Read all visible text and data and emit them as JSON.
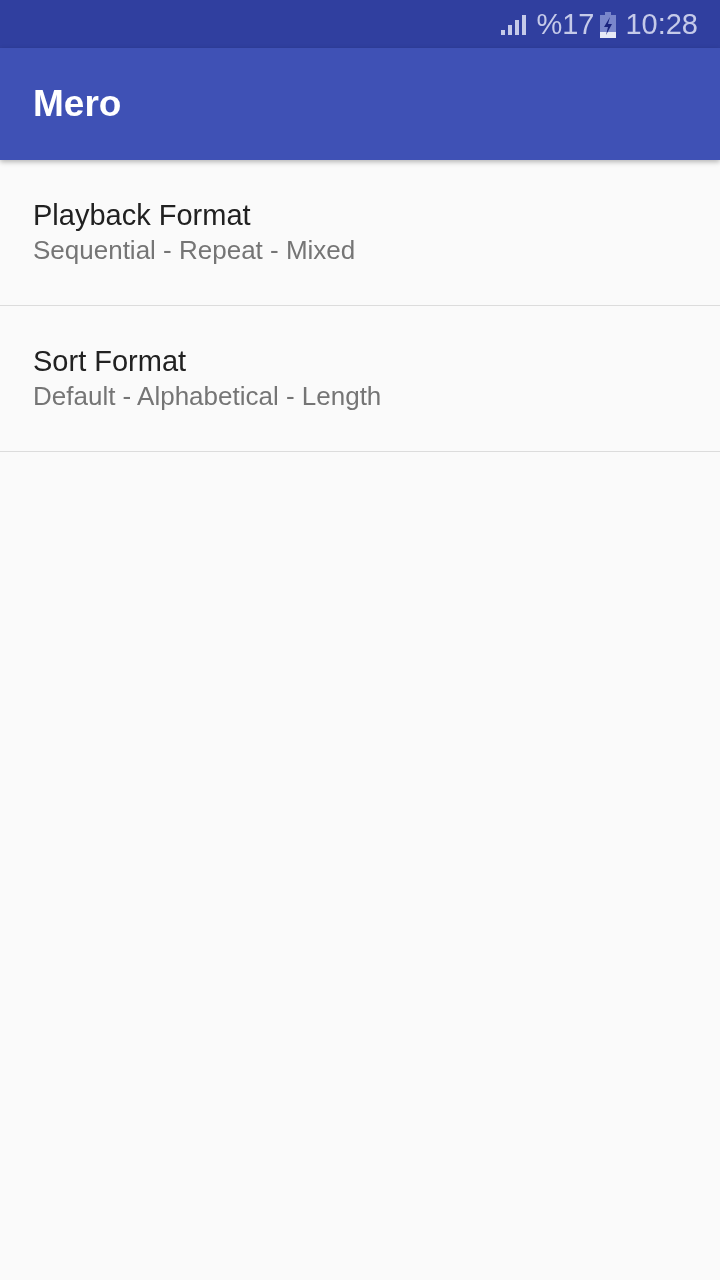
{
  "status_bar": {
    "battery_percent": "%17",
    "time": "10:28"
  },
  "app_bar": {
    "title": "Mero"
  },
  "settings": [
    {
      "title": "Playback Format",
      "summary": "Sequential - Repeat - Mixed"
    },
    {
      "title": "Sort Format",
      "summary": "Default - Alphabetical - Length"
    }
  ]
}
